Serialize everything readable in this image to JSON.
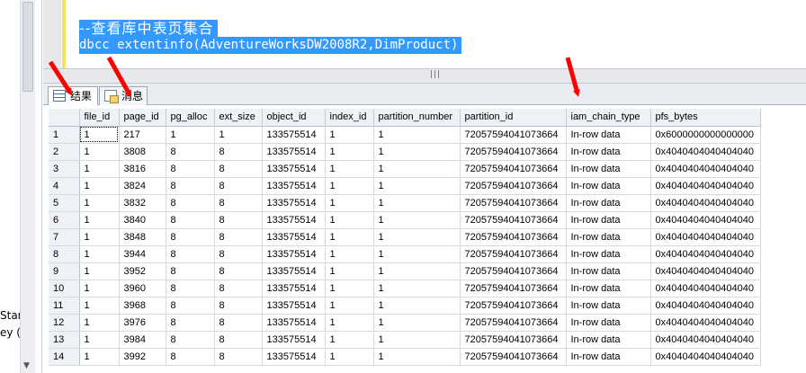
{
  "editor": {
    "lines": [
      "--查看库中表页集合",
      "dbcc extentinfo(AdventureWorksDW2008R2,DimProduct)"
    ]
  },
  "left_panel": {
    "texts": [
      "Start",
      "ey (A"
    ]
  },
  "tabs": [
    {
      "label": "结果",
      "icon": "grid-icon",
      "active": true
    },
    {
      "label": "消息",
      "icon": "document-icon",
      "active": false
    }
  ],
  "grid": {
    "columns": [
      "file_id",
      "page_id",
      "pg_alloc",
      "ext_size",
      "object_id",
      "index_id",
      "partition_number",
      "partition_id",
      "iam_chain_type",
      "pfs_bytes"
    ],
    "rows": [
      {
        "row": "1",
        "cells": [
          "1",
          "217",
          "1",
          "1",
          "133575514",
          "1",
          "1",
          "72057594041073664",
          "In-row data",
          "0x6000000000000000"
        ]
      },
      {
        "row": "2",
        "cells": [
          "1",
          "3808",
          "8",
          "8",
          "133575514",
          "1",
          "1",
          "72057594041073664",
          "In-row data",
          "0x4040404040404040"
        ]
      },
      {
        "row": "3",
        "cells": [
          "1",
          "3816",
          "8",
          "8",
          "133575514",
          "1",
          "1",
          "72057594041073664",
          "In-row data",
          "0x4040404040404040"
        ]
      },
      {
        "row": "4",
        "cells": [
          "1",
          "3824",
          "8",
          "8",
          "133575514",
          "1",
          "1",
          "72057594041073664",
          "In-row data",
          "0x4040404040404040"
        ]
      },
      {
        "row": "5",
        "cells": [
          "1",
          "3832",
          "8",
          "8",
          "133575514",
          "1",
          "1",
          "72057594041073664",
          "In-row data",
          "0x4040404040404040"
        ]
      },
      {
        "row": "6",
        "cells": [
          "1",
          "3840",
          "8",
          "8",
          "133575514",
          "1",
          "1",
          "72057594041073664",
          "In-row data",
          "0x4040404040404040"
        ]
      },
      {
        "row": "7",
        "cells": [
          "1",
          "3848",
          "8",
          "8",
          "133575514",
          "1",
          "1",
          "72057594041073664",
          "In-row data",
          "0x4040404040404040"
        ]
      },
      {
        "row": "8",
        "cells": [
          "1",
          "3944",
          "8",
          "8",
          "133575514",
          "1",
          "1",
          "72057594041073664",
          "In-row data",
          "0x4040404040404040"
        ]
      },
      {
        "row": "9",
        "cells": [
          "1",
          "3952",
          "8",
          "8",
          "133575514",
          "1",
          "1",
          "72057594041073664",
          "In-row data",
          "0x4040404040404040"
        ]
      },
      {
        "row": "10",
        "cells": [
          "1",
          "3960",
          "8",
          "8",
          "133575514",
          "1",
          "1",
          "72057594041073664",
          "In-row data",
          "0x4040404040404040"
        ]
      },
      {
        "row": "11",
        "cells": [
          "1",
          "3968",
          "8",
          "8",
          "133575514",
          "1",
          "1",
          "72057594041073664",
          "In-row data",
          "0x4040404040404040"
        ]
      },
      {
        "row": "12",
        "cells": [
          "1",
          "3976",
          "8",
          "8",
          "133575514",
          "1",
          "1",
          "72057594041073664",
          "In-row data",
          "0x4040404040404040"
        ]
      },
      {
        "row": "13",
        "cells": [
          "1",
          "3984",
          "8",
          "8",
          "133575514",
          "1",
          "1",
          "72057594041073664",
          "In-row data",
          "0x4040404040404040"
        ]
      },
      {
        "row": "14",
        "cells": [
          "1",
          "3992",
          "8",
          "8",
          "133575514",
          "1",
          "1",
          "72057594041073664",
          "In-row data",
          "0x4040404040404040"
        ]
      }
    ]
  },
  "colors": {
    "selection": "#3399ff",
    "annotation_arrow": "#ff0000",
    "change_bar": "#f1e65a"
  }
}
